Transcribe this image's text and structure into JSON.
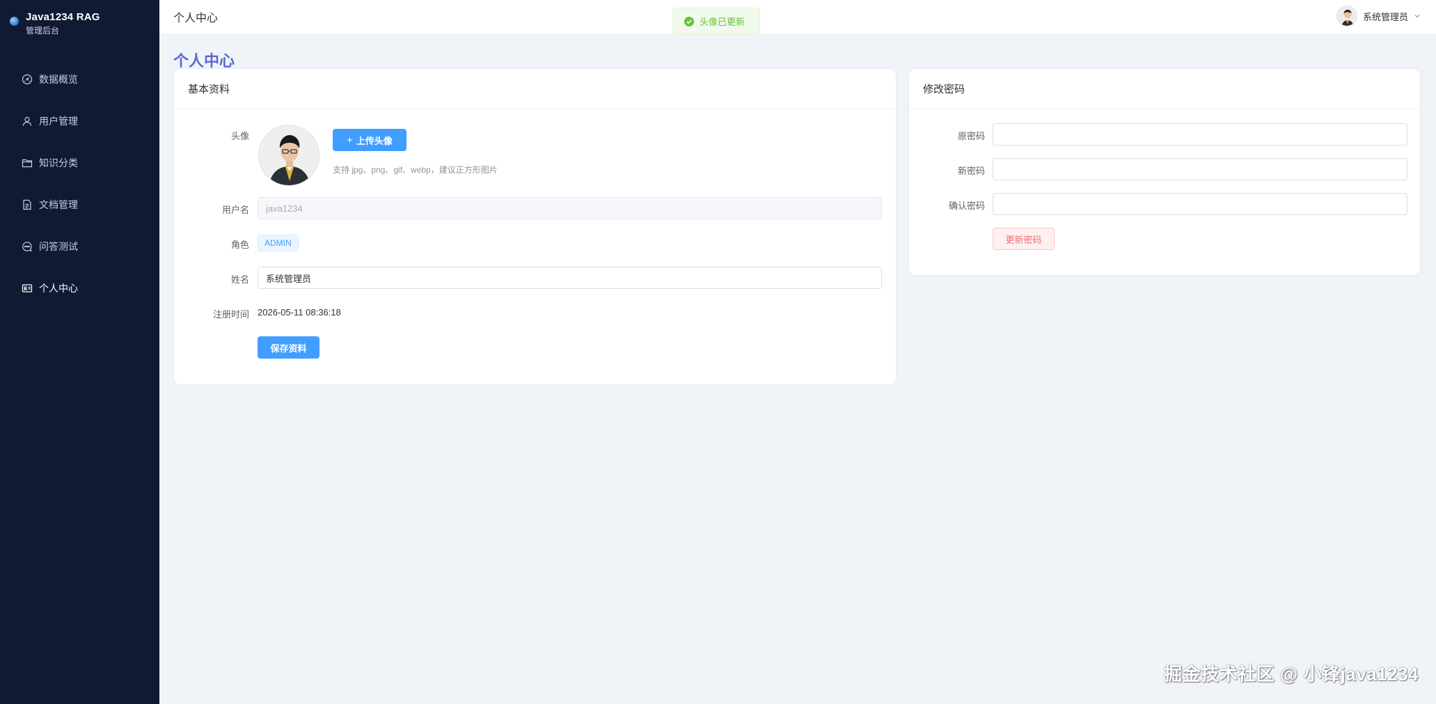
{
  "brand": {
    "title": "Java1234 RAG",
    "subtitle": "管理后台"
  },
  "sidebar": {
    "items": [
      {
        "label": "数据概览",
        "icon": "gauge-icon"
      },
      {
        "label": "用户管理",
        "icon": "user-icon"
      },
      {
        "label": "知识分类",
        "icon": "folder-icon"
      },
      {
        "label": "文档管理",
        "icon": "document-icon"
      },
      {
        "label": "问答测试",
        "icon": "chat-icon"
      },
      {
        "label": "个人中心",
        "icon": "id-card-icon",
        "active": true
      }
    ]
  },
  "header": {
    "title": "个人中心",
    "user_name": "系统管理员"
  },
  "toast": {
    "message": "头像已更新",
    "type": "success"
  },
  "page": {
    "title": "个人中心"
  },
  "profile_card": {
    "title": "基本资料",
    "avatar_label": "头像",
    "upload_button": "上传头像",
    "upload_hint": "支持 jpg、png、gif、webp，建议正方形图片",
    "username_label": "用户名",
    "username_value": "java1234",
    "role_label": "角色",
    "role_value": "ADMIN",
    "name_label": "姓名",
    "name_value": "系统管理员",
    "register_label": "注册时间",
    "register_value": "2026-05-11 08:36:18",
    "save_button": "保存资料"
  },
  "password_card": {
    "title": "修改密码",
    "old_label": "原密码",
    "new_label": "新密码",
    "confirm_label": "确认密码",
    "old_value": "",
    "new_value": "",
    "confirm_value": "",
    "submit_button": "更新密码"
  },
  "watermark": {
    "text": "掘金技术社区 @ 小锋java1234"
  },
  "colors": {
    "sidebar_bg": "#111a33",
    "primary": "#409eff",
    "title_accent": "#5b67d8",
    "success": "#67c23a",
    "danger": "#f56c6c"
  }
}
